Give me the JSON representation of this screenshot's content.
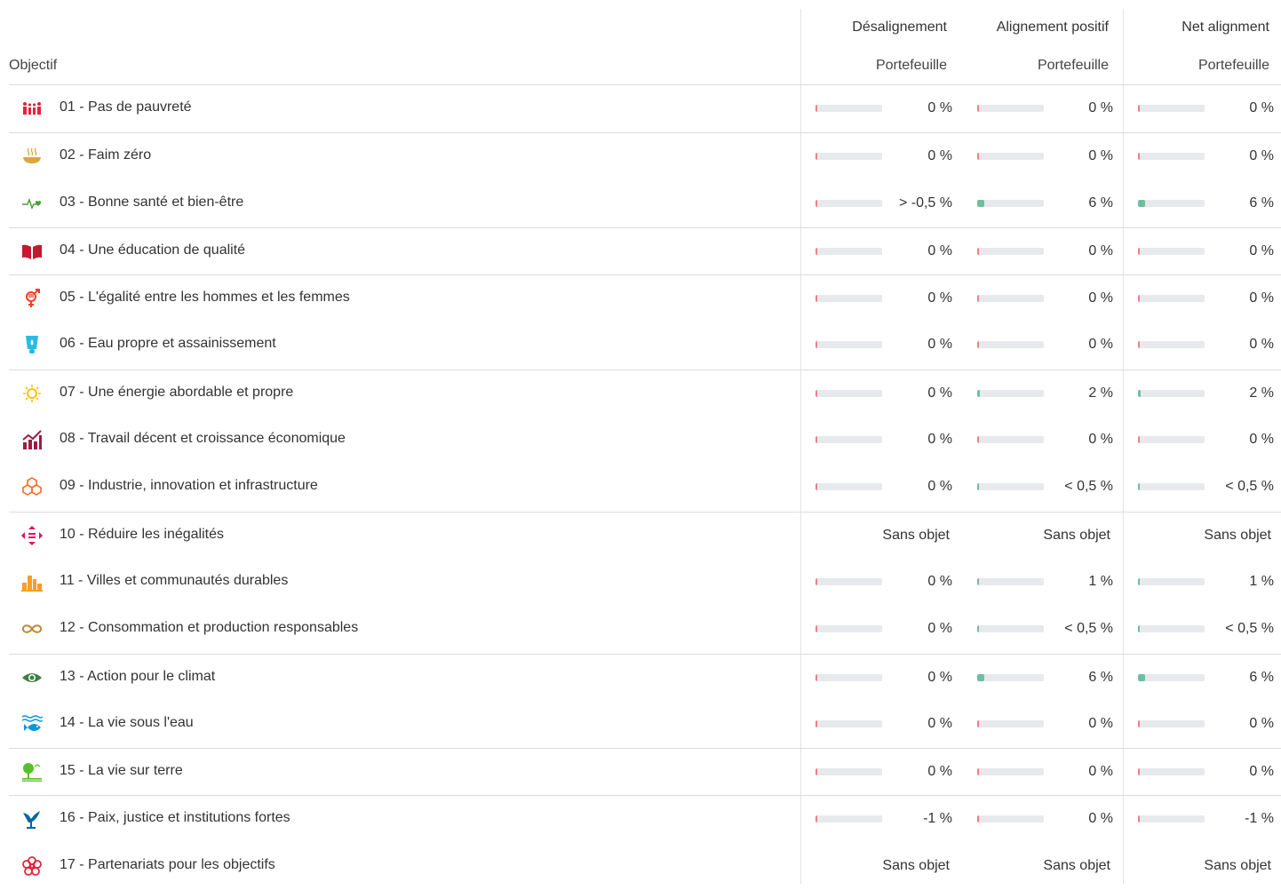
{
  "header": {
    "objective_label": "Objectif",
    "groups": [
      {
        "title": "Désalignement",
        "sub": "Portefeuille"
      },
      {
        "title": "Alignement positif",
        "sub": "Portefeuille"
      },
      {
        "title": "Net alignment",
        "sub": "Portefeuille"
      }
    ]
  },
  "colors": {
    "negative_fill": "#e8808c",
    "positive_fill": "#6dbfa0",
    "bar_track": "#e8e9ec",
    "separator": "#dcdcdc"
  },
  "rows": [
    {
      "label": "01 - Pas de pauvreté",
      "icon": "people-icon",
      "color": "#e5243b",
      "sep": true,
      "cells": [
        {
          "text": "0 %",
          "level": 0,
          "tone": "neg"
        },
        {
          "text": "0 %",
          "level": 0,
          "tone": "neg"
        },
        {
          "text": "0 %",
          "level": 0,
          "tone": "neg"
        }
      ]
    },
    {
      "label": "02 - Faim zéro",
      "icon": "bowl-icon",
      "color": "#dda63a",
      "sep": true,
      "cells": [
        {
          "text": "0 %",
          "level": 0,
          "tone": "neg"
        },
        {
          "text": "0 %",
          "level": 0,
          "tone": "neg"
        },
        {
          "text": "0 %",
          "level": 0,
          "tone": "neg"
        }
      ]
    },
    {
      "label": "03 - Bonne santé et bien-être",
      "icon": "heartbeat-icon",
      "color": "#4c9f38",
      "sep": false,
      "cells": [
        {
          "text": "> -0,5 %",
          "level": 0,
          "tone": "neg"
        },
        {
          "text": "6 %",
          "level": 6,
          "tone": "pos"
        },
        {
          "text": "6 %",
          "level": 6,
          "tone": "pos"
        }
      ]
    },
    {
      "label": "04 - Une éducation de qualité",
      "icon": "book-icon",
      "color": "#c5192d",
      "sep": true,
      "cells": [
        {
          "text": "0 %",
          "level": 0,
          "tone": "neg"
        },
        {
          "text": "0 %",
          "level": 0,
          "tone": "neg"
        },
        {
          "text": "0 %",
          "level": 0,
          "tone": "neg"
        }
      ]
    },
    {
      "label": "05 - L'égalité entre les hommes et les femmes",
      "icon": "gender-icon",
      "color": "#ff3a21",
      "sep": true,
      "cells": [
        {
          "text": "0 %",
          "level": 0,
          "tone": "neg"
        },
        {
          "text": "0 %",
          "level": 0,
          "tone": "neg"
        },
        {
          "text": "0 %",
          "level": 0,
          "tone": "neg"
        }
      ]
    },
    {
      "label": "06 - Eau propre et assainissement",
      "icon": "water-icon",
      "color": "#26bde2",
      "sep": false,
      "cells": [
        {
          "text": "0 %",
          "level": 0,
          "tone": "neg"
        },
        {
          "text": "0 %",
          "level": 0,
          "tone": "neg"
        },
        {
          "text": "0 %",
          "level": 0,
          "tone": "neg"
        }
      ]
    },
    {
      "label": "07 - Une énergie abordable et propre",
      "icon": "sun-icon",
      "color": "#fcc30b",
      "sep": true,
      "cells": [
        {
          "text": "0 %",
          "level": 0,
          "tone": "neg"
        },
        {
          "text": "2 %",
          "level": 2,
          "tone": "pos"
        },
        {
          "text": "2 %",
          "level": 2,
          "tone": "pos"
        }
      ]
    },
    {
      "label": "08 - Travail décent et croissance économique",
      "icon": "growth-chart-icon",
      "color": "#a21942",
      "sep": false,
      "cells": [
        {
          "text": "0 %",
          "level": 0,
          "tone": "neg"
        },
        {
          "text": "0 %",
          "level": 0,
          "tone": "neg"
        },
        {
          "text": "0 %",
          "level": 0,
          "tone": "neg"
        }
      ]
    },
    {
      "label": "09 - Industrie, innovation et infrastructure",
      "icon": "cubes-icon",
      "color": "#fd6925",
      "sep": false,
      "cells": [
        {
          "text": "0 %",
          "level": 0,
          "tone": "neg"
        },
        {
          "text": "< 0,5 %",
          "level": 0.3,
          "tone": "pos"
        },
        {
          "text": "< 0,5 %",
          "level": 0.3,
          "tone": "pos"
        }
      ]
    },
    {
      "label": "10 - Réduire les inégalités",
      "icon": "equality-icon",
      "color": "#dd1367",
      "sep": true,
      "na": "Sans objet"
    },
    {
      "label": "11 - Villes et communautés durables",
      "icon": "city-icon",
      "color": "#fd9d24",
      "sep": false,
      "cells": [
        {
          "text": "0 %",
          "level": 0,
          "tone": "neg"
        },
        {
          "text": "1 %",
          "level": 1,
          "tone": "pos"
        },
        {
          "text": "1 %",
          "level": 1,
          "tone": "pos"
        }
      ]
    },
    {
      "label": "12 - Consommation et production responsables",
      "icon": "infinity-icon",
      "color": "#bf8b2e",
      "sep": false,
      "cells": [
        {
          "text": "0 %",
          "level": 0,
          "tone": "neg"
        },
        {
          "text": "< 0,5 %",
          "level": 0.3,
          "tone": "pos"
        },
        {
          "text": "< 0,5 %",
          "level": 0.3,
          "tone": "pos"
        }
      ]
    },
    {
      "label": "13 - Action pour le climat",
      "icon": "eye-globe-icon",
      "color": "#3f7e44",
      "sep": true,
      "cells": [
        {
          "text": "0 %",
          "level": 0,
          "tone": "neg"
        },
        {
          "text": "6 %",
          "level": 6,
          "tone": "pos"
        },
        {
          "text": "6 %",
          "level": 6,
          "tone": "pos"
        }
      ]
    },
    {
      "label": "14 - La vie sous l'eau",
      "icon": "fish-icon",
      "color": "#0a97d9",
      "sep": false,
      "cells": [
        {
          "text": "0 %",
          "level": 0,
          "tone": "neg"
        },
        {
          "text": "0 %",
          "level": 0,
          "tone": "neg"
        },
        {
          "text": "0 %",
          "level": 0,
          "tone": "neg"
        }
      ]
    },
    {
      "label": "15 - La vie sur terre",
      "icon": "tree-icon",
      "color": "#56c02b",
      "sep": true,
      "cells": [
        {
          "text": "0 %",
          "level": 0,
          "tone": "neg"
        },
        {
          "text": "0 %",
          "level": 0,
          "tone": "neg"
        },
        {
          "text": "0 %",
          "level": 0,
          "tone": "neg"
        }
      ]
    },
    {
      "label": "16 - Paix, justice et institutions fortes",
      "icon": "dove-icon",
      "color": "#00689d",
      "sep": true,
      "cells": [
        {
          "text": "-1 %",
          "level": 1,
          "tone": "neg"
        },
        {
          "text": "0 %",
          "level": 0,
          "tone": "neg"
        },
        {
          "text": "-1 %",
          "level": 1,
          "tone": "neg"
        }
      ]
    },
    {
      "label": "17 - Partenariats pour les objectifs",
      "icon": "flower-rings-icon",
      "color": "#e5243b",
      "sep": false,
      "na": "Sans objet"
    }
  ]
}
